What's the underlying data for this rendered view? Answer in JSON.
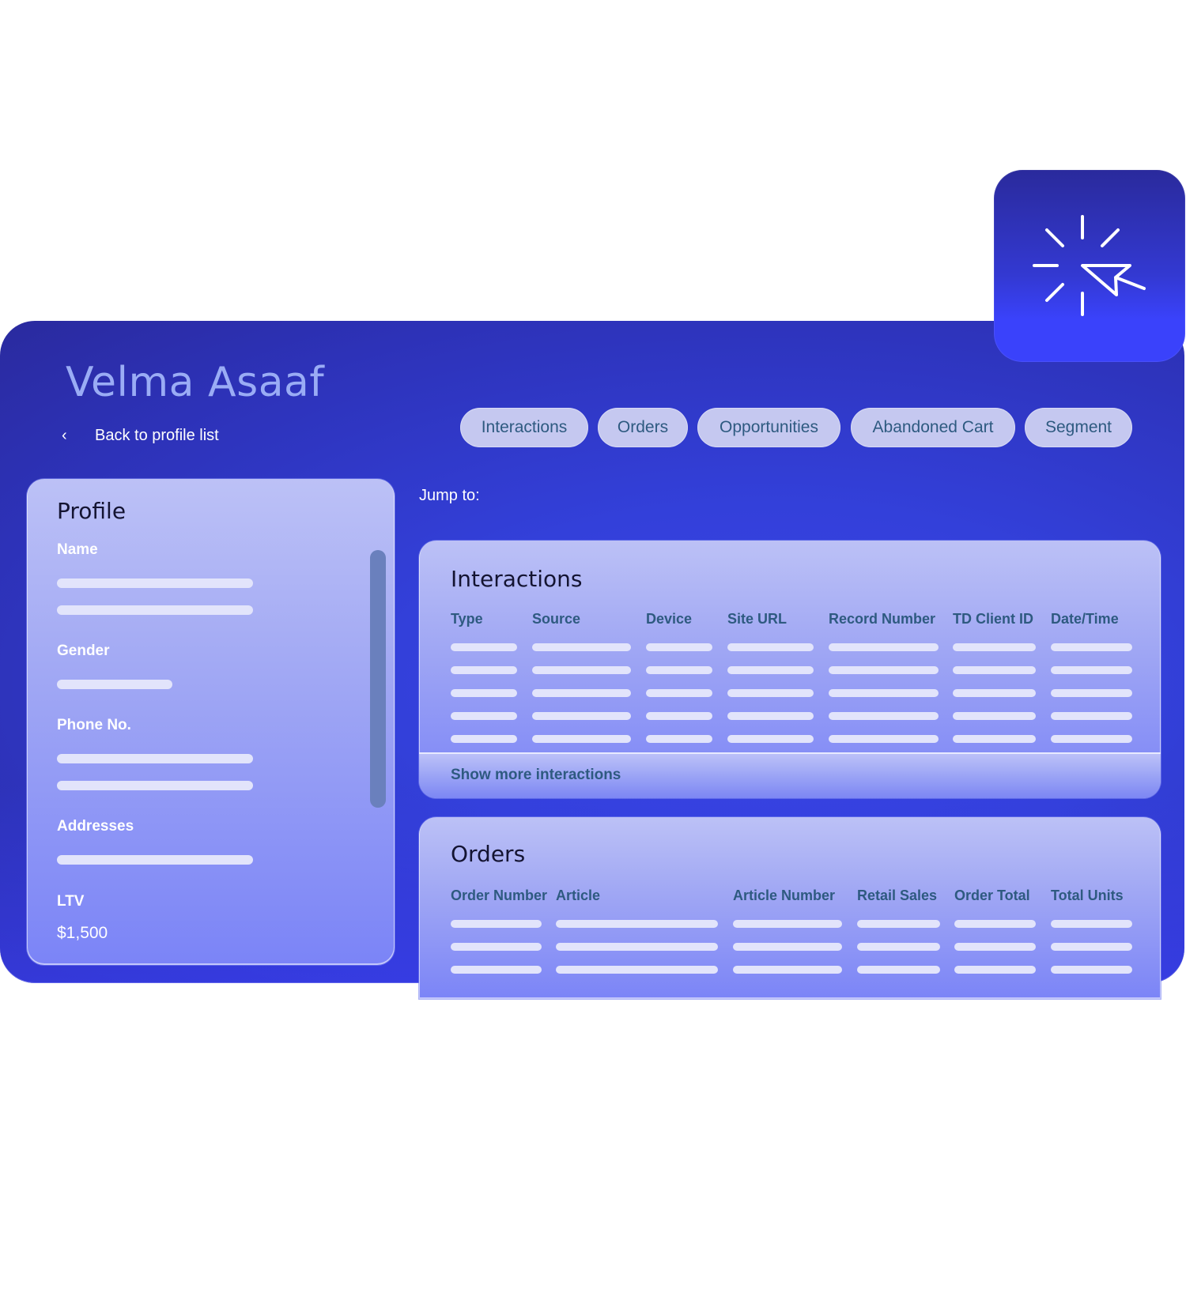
{
  "header": {
    "profile_name": "Velma Asaaf",
    "back_link": "Back to profile list",
    "back_icon": "chevron-left-icon"
  },
  "badge_icon": "click-cursor-icon",
  "tabs": [
    {
      "label": "Interactions"
    },
    {
      "label": "Orders"
    },
    {
      "label": "Opportunities"
    },
    {
      "label": "Abandoned Cart"
    },
    {
      "label": "Segment"
    }
  ],
  "jump_to": "Jump to:",
  "profile": {
    "title": "Profile",
    "fields": [
      {
        "label": "Name",
        "placeholder_lines": 2
      },
      {
        "label": "Gender",
        "placeholder_lines": 1
      },
      {
        "label": "Phone No.",
        "placeholder_lines": 2
      },
      {
        "label": "Addresses",
        "placeholder_lines": 1
      },
      {
        "label": "LTV",
        "value": "$1,500"
      }
    ]
  },
  "interactions": {
    "title": "Interactions",
    "columns": [
      "Type",
      "Source",
      "Device",
      "Site URL",
      "Record Number",
      "TD Client ID",
      "Date/Time"
    ],
    "placeholder_rows": 5,
    "show_more": "Show more interactions"
  },
  "orders": {
    "title": "Orders",
    "columns": [
      "Order Number",
      "Article",
      "Article Number",
      "Retail Sales",
      "Order Total",
      "Total Units"
    ],
    "placeholder_rows": 3
  },
  "colors": {
    "background": "#ffffff",
    "card_blue": "#3340da",
    "accent_blue": "#3a42fb",
    "title_text": "#9aacf5",
    "pill_bg": "#c5c8f0",
    "pill_text": "#2e5a80",
    "placeholder_bar": "#e2e4fb",
    "scrollbar": "#6a80bd"
  }
}
